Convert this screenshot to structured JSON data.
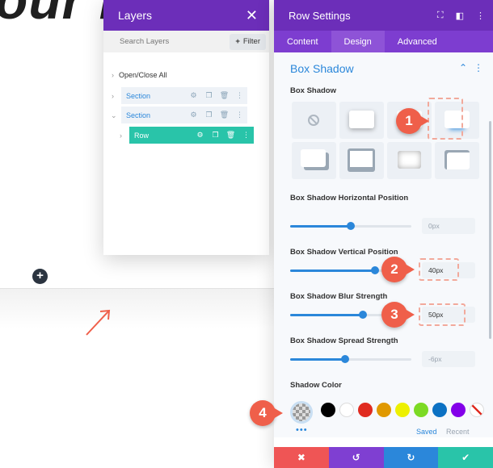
{
  "canvas": {
    "hero_text": "our R",
    "add_icon": "plus-circle-icon"
  },
  "layers": {
    "title": "Layers",
    "search_placeholder": "Search Layers",
    "filter_label": "Filter",
    "open_close_label": "Open/Close All",
    "items": [
      {
        "label": "Section"
      },
      {
        "label": "Section"
      },
      {
        "label": "Row"
      }
    ]
  },
  "settings": {
    "title": "Row Settings",
    "tabs": [
      "Content",
      "Design",
      "Advanced"
    ],
    "active_tab": "Design",
    "group_title": "Box Shadow",
    "box_shadow_label": "Box Shadow",
    "horizontal": {
      "label": "Box Shadow Horizontal Position",
      "value": "0px",
      "percent": 50
    },
    "vertical": {
      "label": "Box Shadow Vertical Position",
      "value": "40px",
      "percent": 70
    },
    "blur": {
      "label": "Box Shadow Blur Strength",
      "value": "50px",
      "percent": 60
    },
    "spread": {
      "label": "Box Shadow Spread Strength",
      "value": "-6px",
      "percent": 45
    },
    "shadow_color_label": "Shadow Color",
    "palette": [
      "#000000",
      "#ffffff",
      "#e02b20",
      "#e09900",
      "#edf000",
      "#7cda24",
      "#0c71c3",
      "#8300e9"
    ],
    "saved_label": "Saved",
    "recent_label": "Recent",
    "more": "•••"
  },
  "footer": {
    "cancel": "✖",
    "undo": "↺",
    "redo": "↻",
    "save": "✔",
    "colors": [
      "#ef5555",
      "#7f3fd2",
      "#2b87da",
      "#29c4a9"
    ]
  },
  "annotations": [
    "1",
    "2",
    "3",
    "4"
  ],
  "colors": {
    "accent": "#6c2eb9",
    "blue": "#2b87da",
    "green": "#29c4a9",
    "annotation": "#ef5f4a"
  }
}
